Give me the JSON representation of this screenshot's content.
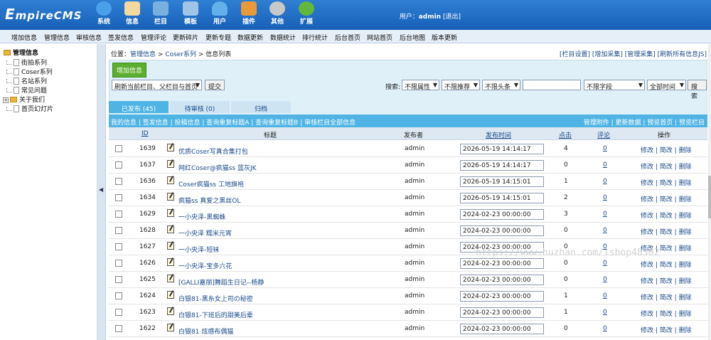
{
  "brand": {
    "logo_e": "E",
    "logo_rest": "mpireCMS"
  },
  "nav": [
    {
      "label": "系统",
      "color": "#4aa0e8"
    },
    {
      "label": "信息",
      "color": "#f3d9a0"
    },
    {
      "label": "栏目",
      "color": "#7ab0e0"
    },
    {
      "label": "模板",
      "color": "#a0c4e8"
    },
    {
      "label": "用户",
      "color": "#63b0ea"
    },
    {
      "label": "插件",
      "color": "#e89a3a"
    },
    {
      "label": "其他",
      "color": "#c8c8c8"
    },
    {
      "label": "扩展",
      "color": "#62b83c"
    }
  ],
  "user": {
    "prefix": "用户：",
    "name": "admin",
    "logout": "[退出]"
  },
  "menu": [
    "增加信息",
    "管理信息",
    "审核信息",
    "签发信息",
    "管理评论",
    "更新碎片",
    "更新专题",
    "数据更新",
    "数据统计",
    "排行统计",
    "后台首页",
    "网站首页",
    "后台地图",
    "版本更新"
  ],
  "sidebar": {
    "root": "管理信息",
    "items": [
      "街拍系列",
      "Coser系列",
      "名站系列",
      "常见问题",
      "关于我们",
      "首页幻灯片"
    ]
  },
  "splitter_arrow": "◀",
  "breadcrumb": {
    "prefix": "位置：",
    "a": "管理信息",
    "sep1": " > ",
    "b": "Coser系列",
    "sep2": " > ",
    "c": "信息列表"
  },
  "top_links": "[栏目设置] [增加采集] [管理采集] [刷新所有信息JS]",
  "toolbar": {
    "add": "增加信息",
    "refresh_select": "刷新当前栏目、父栏目与首页",
    "submit": "提交",
    "search_label": "搜索:",
    "attr": "不限属性",
    "recommend": "不限推荐",
    "headline": "不限头条",
    "search_value": "",
    "field": "不限字段",
    "time": "全部时间",
    "search_btn": "搜索"
  },
  "tabs": [
    "已发布 (45)",
    "待审核 (0)",
    "归档"
  ],
  "caption_left": "我的信息 | 签发信息 | 投稿信息 | 查询重复标题A | 查询重复标题B | 审核栏目全部信息",
  "caption_right": "管理附件 | 更新数据 | 预览首页 | 预览栏目",
  "headers": {
    "id": "ID",
    "title": "标题",
    "author": "发布者",
    "time": "发布时间",
    "clicks": "点击",
    "comments": "评论",
    "ops": "操作"
  },
  "ops": {
    "edit": "修改",
    "simple": "简改",
    "del": "删除",
    "sep": " | "
  },
  "rows": [
    {
      "id": "1639",
      "title": "优质Coser写真合集打包",
      "author": "admin",
      "time": "2026-05-19 14:14:17",
      "clicks": "4",
      "comments": "0"
    },
    {
      "id": "1637",
      "title": "网红Coser@疯猫ss 蓝灰JK",
      "author": "admin",
      "time": "2026-05-19 14:14:17",
      "clicks": "0",
      "comments": "0"
    },
    {
      "id": "1636",
      "title": "Coser疯猫ss 工地旗袍",
      "author": "admin",
      "time": "2026-05-19 14:15:01",
      "clicks": "1",
      "comments": "0"
    },
    {
      "id": "1634",
      "title": "疯猫ss 真爱之黑丝OL",
      "author": "admin",
      "time": "2026-05-19 14:15:01",
      "clicks": "2",
      "comments": "0"
    },
    {
      "id": "1629",
      "title": "一小央泽-黑蜘蛛",
      "author": "admin",
      "time": "2024-02-23 00:00:00",
      "clicks": "3",
      "comments": "0"
    },
    {
      "id": "1628",
      "title": "一小央泽 糯米元宵",
      "author": "admin",
      "time": "2024-02-23 00:00:00",
      "clicks": "0",
      "comments": "0"
    },
    {
      "id": "1627",
      "title": "一小央泽-短袜",
      "author": "admin",
      "time": "2024-02-23 00:00:00",
      "clicks": "0",
      "comments": "0"
    },
    {
      "id": "1626",
      "title": "一小央泽-宝多六花",
      "author": "admin",
      "time": "2024-02-23 00:00:00",
      "clicks": "0",
      "comments": "0"
    },
    {
      "id": "1625",
      "title": "[GALLI嘉丽]舞蹈生日记--杨静",
      "author": "admin",
      "time": "2024-02-23 00:00:00",
      "clicks": "0",
      "comments": "0"
    },
    {
      "id": "1624",
      "title": "白银81-黑糸女上司の秘密",
      "author": "admin",
      "time": "2024-02-23 00:00:00",
      "clicks": "1",
      "comments": "0"
    },
    {
      "id": "1623",
      "title": "白银81-下班后的甜美后辈",
      "author": "admin",
      "time": "2024-02-23 00:00:00",
      "clicks": "1",
      "comments": "0"
    },
    {
      "id": "1622",
      "title": "白银81 炫感布偶猫",
      "author": "admin",
      "time": "2024-02-23 00:00:00",
      "clicks": "0",
      "comments": "0"
    }
  ],
  "watermark": "https://www.huzhan.com/ishop48302"
}
